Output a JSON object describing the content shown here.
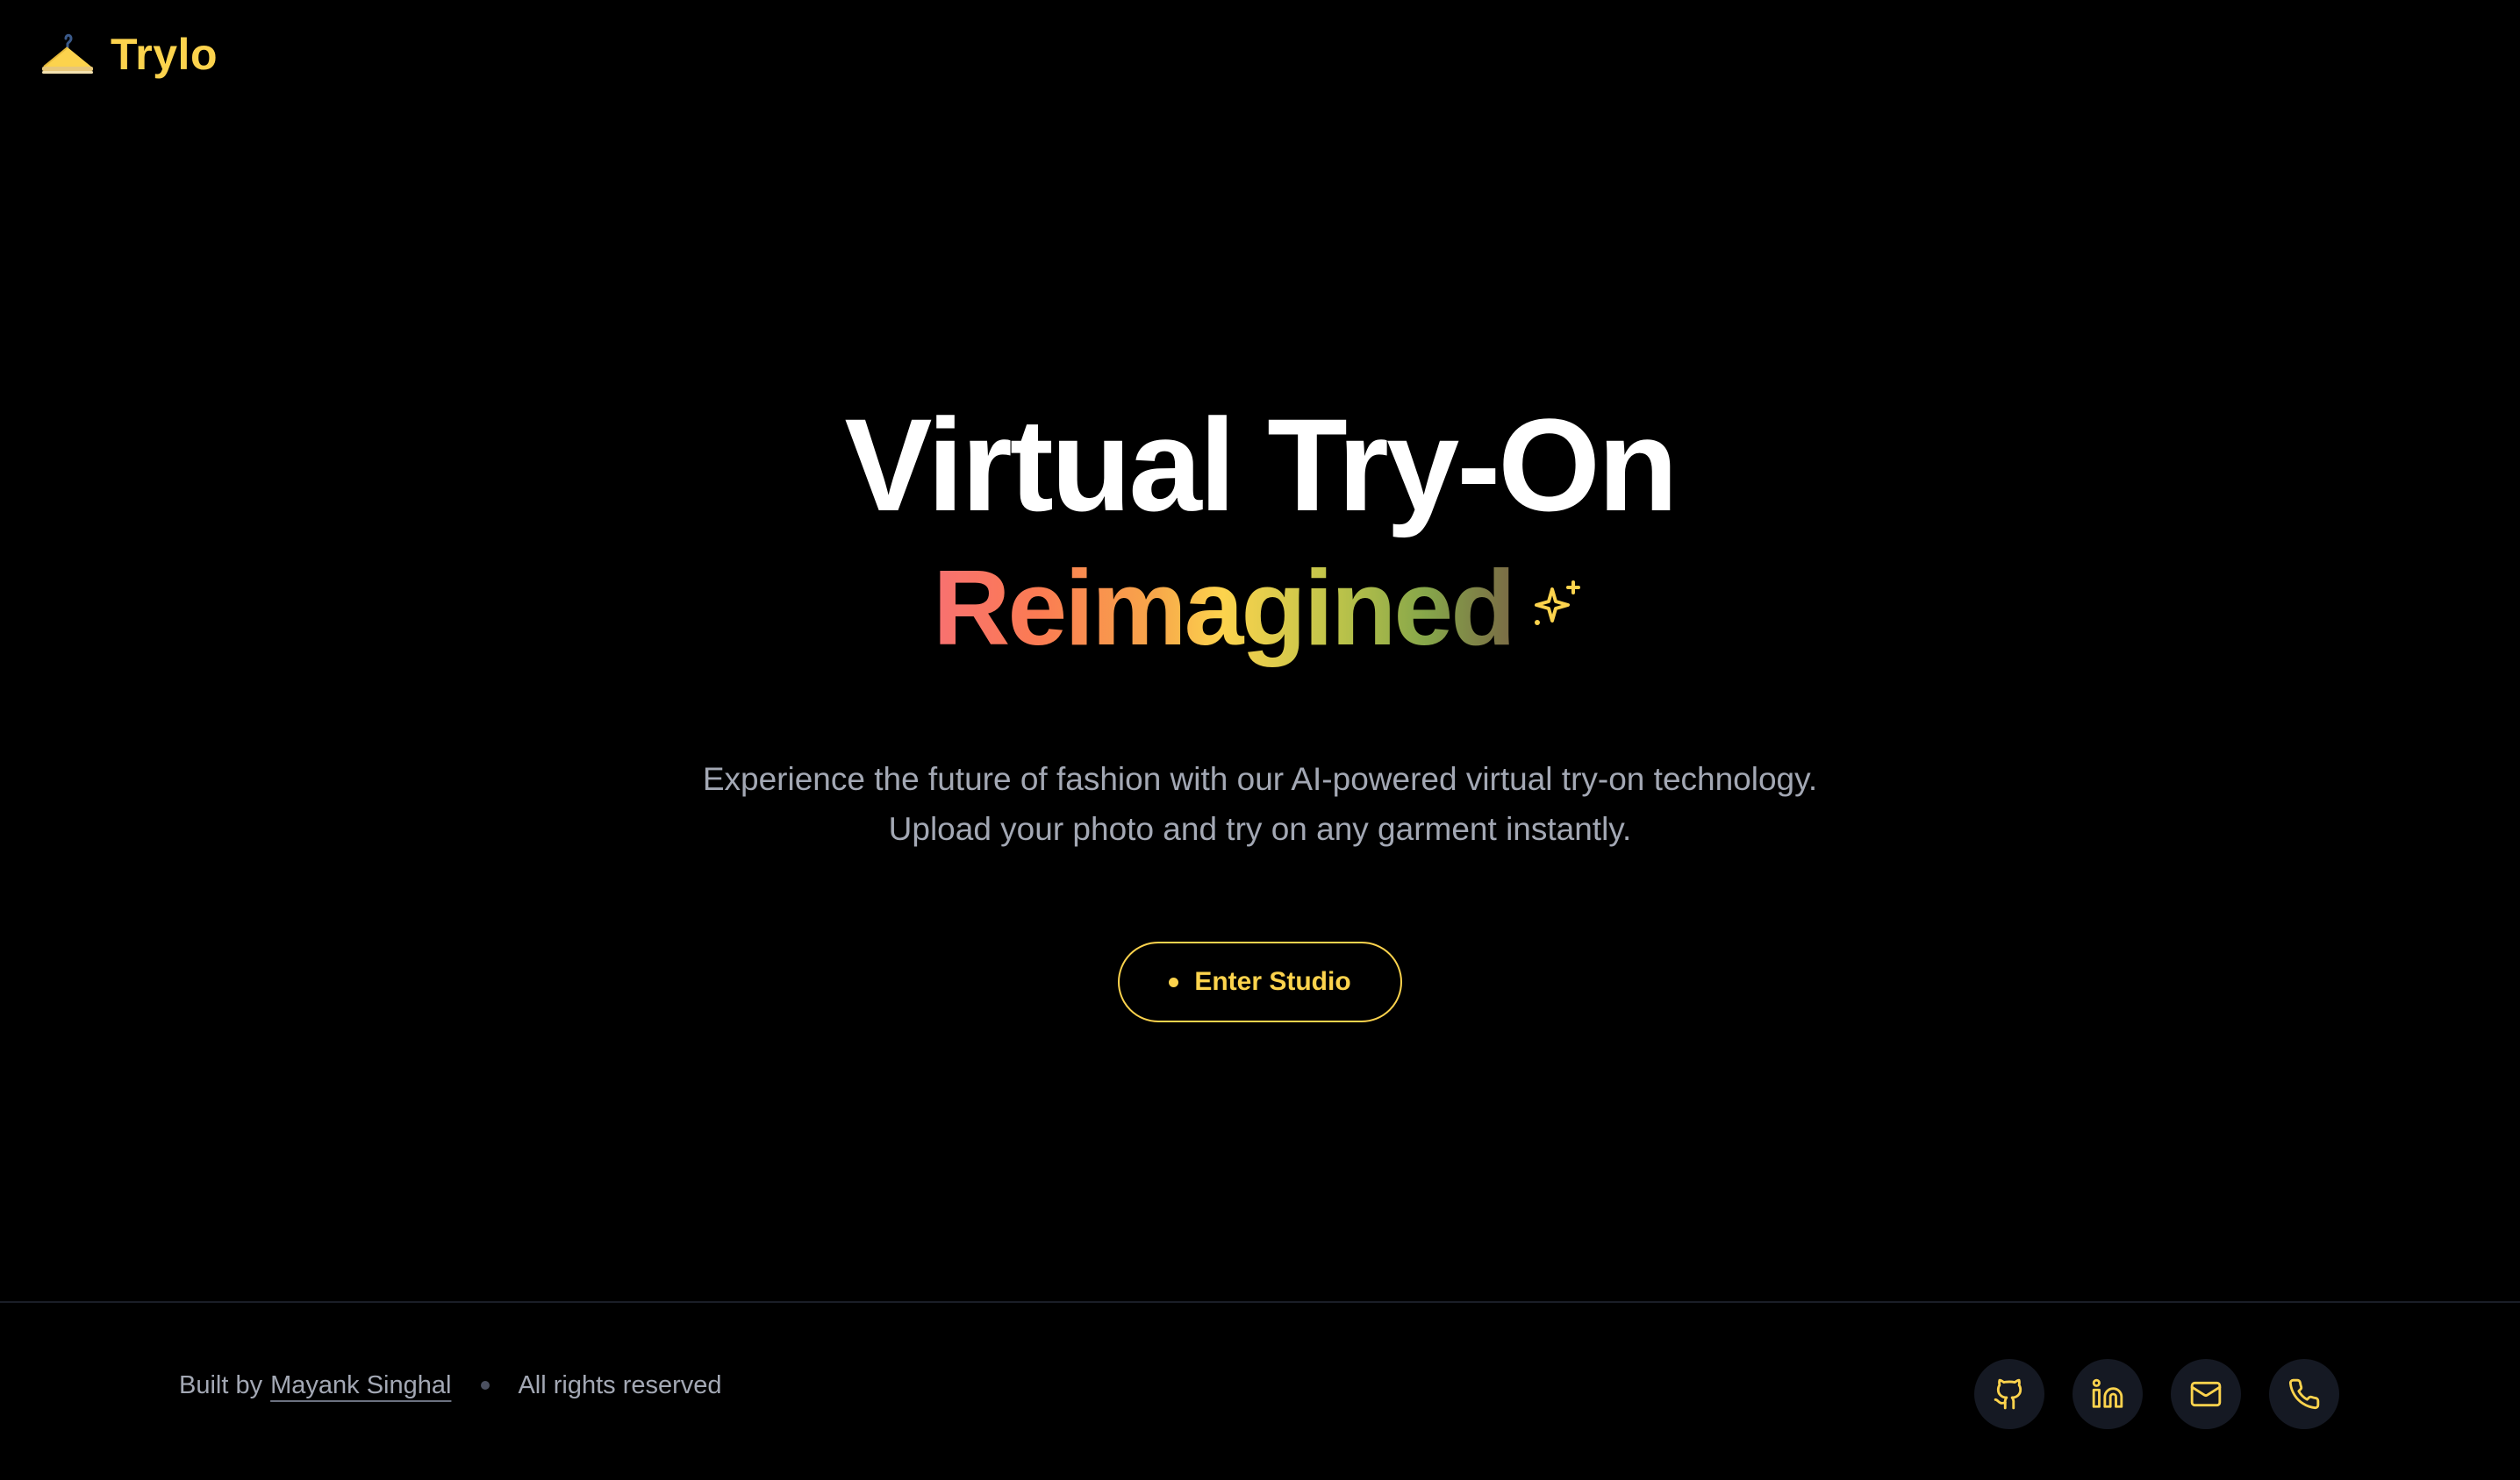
{
  "brand": {
    "name": "Trylo",
    "icon": "hanger-icon",
    "color": "#fcd34d"
  },
  "hero": {
    "title": "Virtual Try-On",
    "subtitle": "Reimagined",
    "subtitle_icon": "sparkle-icon",
    "description_line1": "Experience the future of fashion with our AI-powered virtual try-on technology.",
    "description_line2": "Upload your photo and try on any garment instantly.",
    "cta_label": "Enter Studio"
  },
  "footer": {
    "built_by_prefix": "Built by",
    "author": "Mayank Singhal",
    "rights": "All rights reserved",
    "social": [
      {
        "icon": "github-icon"
      },
      {
        "icon": "linkedin-icon"
      },
      {
        "icon": "mail-icon"
      },
      {
        "icon": "phone-icon"
      }
    ]
  },
  "colors": {
    "background": "#000000",
    "accent": "#fcd34d",
    "muted_text": "#a3a8b4",
    "icon_button_bg": "#151923"
  }
}
